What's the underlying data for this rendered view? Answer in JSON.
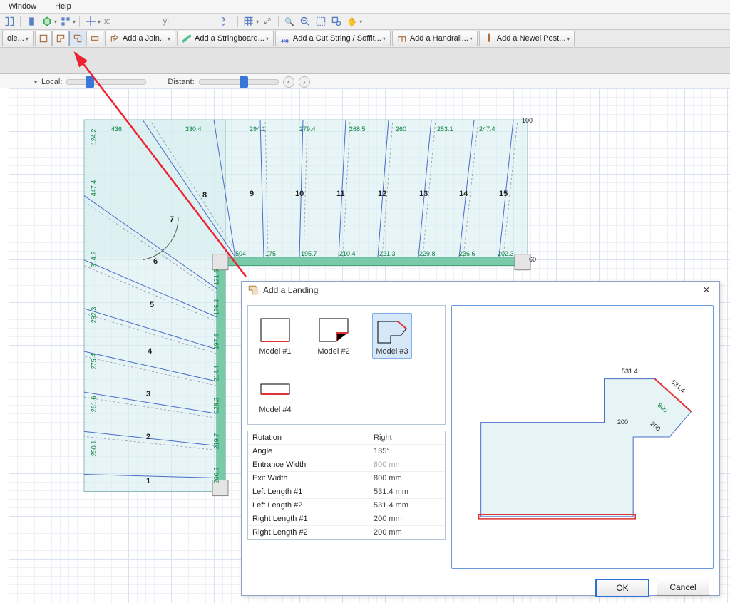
{
  "menu": {
    "window": "Window",
    "help": "Help"
  },
  "toolbar_coord": {
    "x_label": "x:",
    "y_label": "y:"
  },
  "toolbar_actions": {
    "hole_btn": "ole...",
    "add_join": "Add a Join...",
    "add_stringboard": "Add a Stringboard...",
    "add_cutstring": "Add a Cut String / Soffit...",
    "add_handrail": "Add a Handrail...",
    "add_newel": "Add a Newel Post..."
  },
  "sliders": {
    "local": "Local:",
    "distant": "Distant:"
  },
  "stair": {
    "top_dims": [
      "436",
      "330.4",
      "294.1",
      "279.4",
      "268.5",
      "260",
      "253.1",
      "247.4"
    ],
    "top_right": "100",
    "bottom_dims": [
      "504",
      "175",
      "195.7",
      "210.4",
      "221.3",
      "229.8",
      "236.6",
      "202.3"
    ],
    "bottom_right": "60",
    "left_dims_outer": [
      "124.2",
      "447.4",
      "314.2",
      "292.3",
      "275.4",
      "261.6",
      "250.1"
    ],
    "right_dims_inner": [
      "121.5",
      "176.3",
      "197.5",
      "214.4",
      "228.2",
      "219.7",
      "200.2"
    ],
    "numbers": [
      "1",
      "2",
      "3",
      "4",
      "5",
      "6",
      "7",
      "8",
      "9",
      "10",
      "11",
      "12",
      "13",
      "14",
      "15"
    ]
  },
  "dialog": {
    "title": "Add a Landing",
    "models": {
      "m1": "Model #1",
      "m2": "Model #2",
      "m3": "Model #3",
      "m4": "Model #4"
    },
    "props": [
      {
        "k": "Rotation",
        "v": "Right"
      },
      {
        "k": "Angle",
        "v": "135°"
      },
      {
        "k": "Entrance Width",
        "v": "800 mm",
        "dim": true
      },
      {
        "k": "Exit Width",
        "v": "800 mm"
      },
      {
        "k": "Left Length #1",
        "v": "531.4 mm"
      },
      {
        "k": "Left Length #2",
        "v": "531.4 mm"
      },
      {
        "k": "Right Length #1",
        "v": "200 mm"
      },
      {
        "k": "Right Length #2",
        "v": "200 mm"
      }
    ],
    "preview_labels": {
      "top": "531.4",
      "right_top": "531.4",
      "diag": "800",
      "left_short": "200",
      "right_short": "200"
    },
    "ok": "OK",
    "cancel": "Cancel"
  }
}
